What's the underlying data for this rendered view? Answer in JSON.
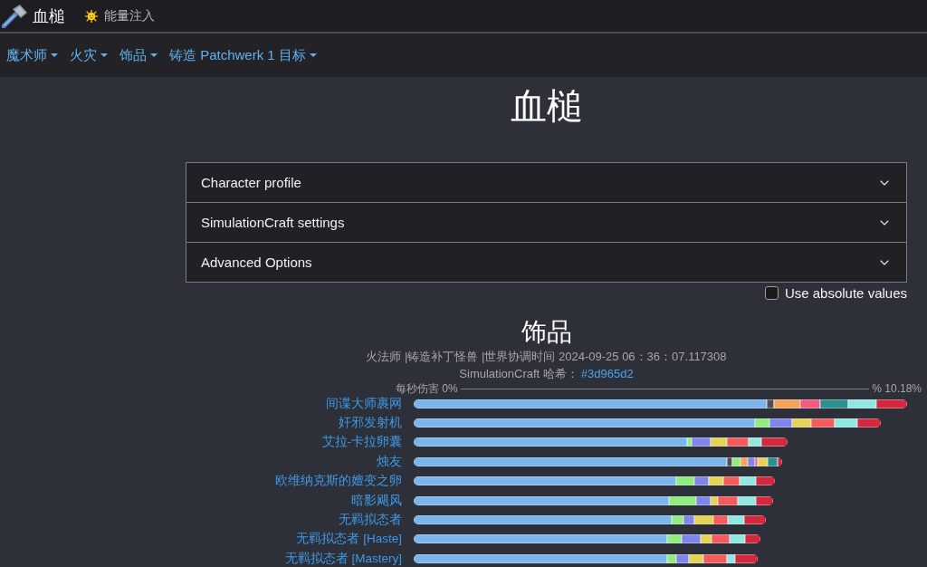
{
  "header": {
    "title": "血槌",
    "badge": {
      "label": "能量注入"
    }
  },
  "nav": {
    "items": [
      {
        "label": "魔术师"
      },
      {
        "label": "火灾"
      },
      {
        "label": "饰品"
      },
      {
        "label": "铸造 Patchwerk 1 目标"
      }
    ]
  },
  "page_title": "血槌",
  "accordion": {
    "sections": [
      {
        "title": "Character profile",
        "expanded": false
      },
      {
        "title": "SimulationCraft settings",
        "expanded": false
      },
      {
        "title": "Advanced Options",
        "expanded": false
      }
    ]
  },
  "absolute_values": {
    "label": "Use absolute values",
    "checked": false
  },
  "results": {
    "title": "饰品",
    "meta": "火法师 |铸造补丁怪兽 |世界协调时间 2024-09-25 06：36：07.117308",
    "hash_label": "SimulationCraft 哈希：",
    "hash": "#3d965d2",
    "scale": {
      "start": "每秒伤害 0%",
      "end": "% 10.18%"
    },
    "rows": [
      {
        "label": "间谍大师裹网"
      },
      {
        "label": "奸邪发射机"
      },
      {
        "label": "艾拉-卡拉卵囊"
      },
      {
        "label": "烛友"
      },
      {
        "label": "欧维纳克斯的嬗变之卵"
      },
      {
        "label": "暗影飓风"
      },
      {
        "label": "无羁拟态者"
      },
      {
        "label": "无羁拟态者 [Haste]"
      },
      {
        "label": "无羁拟态者 [Mastery]"
      }
    ]
  }
}
